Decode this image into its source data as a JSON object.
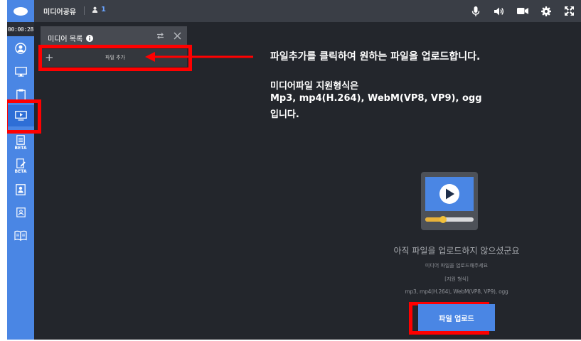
{
  "header": {
    "title": "미디어공유",
    "participant_count": "1"
  },
  "sidebar": {
    "timer": "00:00:28",
    "items": [
      {
        "name": "profile",
        "beta": ""
      },
      {
        "name": "screen",
        "beta": ""
      },
      {
        "name": "clipboard",
        "beta": ""
      },
      {
        "name": "media-share",
        "beta": ""
      },
      {
        "name": "document-beta",
        "beta": "BETA"
      },
      {
        "name": "edit-beta",
        "beta": "BETA"
      },
      {
        "name": "contact-book",
        "beta": ""
      },
      {
        "name": "id-card",
        "beta": ""
      },
      {
        "name": "book",
        "beta": ""
      }
    ]
  },
  "media_panel": {
    "title": "미디어 목록",
    "add_label": "파일 추가"
  },
  "annotation": {
    "line1": "파일추가를 클릭하여 원하는 파일을 업로드합니다.",
    "line2": "미디어파일 지원형식은",
    "line3": "Mp3, mp4(H.264), WebM(VP8, VP9), ogg",
    "line4": "입니다."
  },
  "empty_state": {
    "title": "아직 파일을 업로드하지 않으셨군요",
    "subtitle": "미디어 파일을 업로드해주세요",
    "formats_label": "[지원 형식]",
    "formats": "mp3, mp4(H.264), WebM(VP8, VP9), ogg",
    "upload_button": "파일 업로드"
  },
  "colors": {
    "accent": "#4a86e4",
    "highlight": "#ff0000",
    "background": "#23262c"
  }
}
